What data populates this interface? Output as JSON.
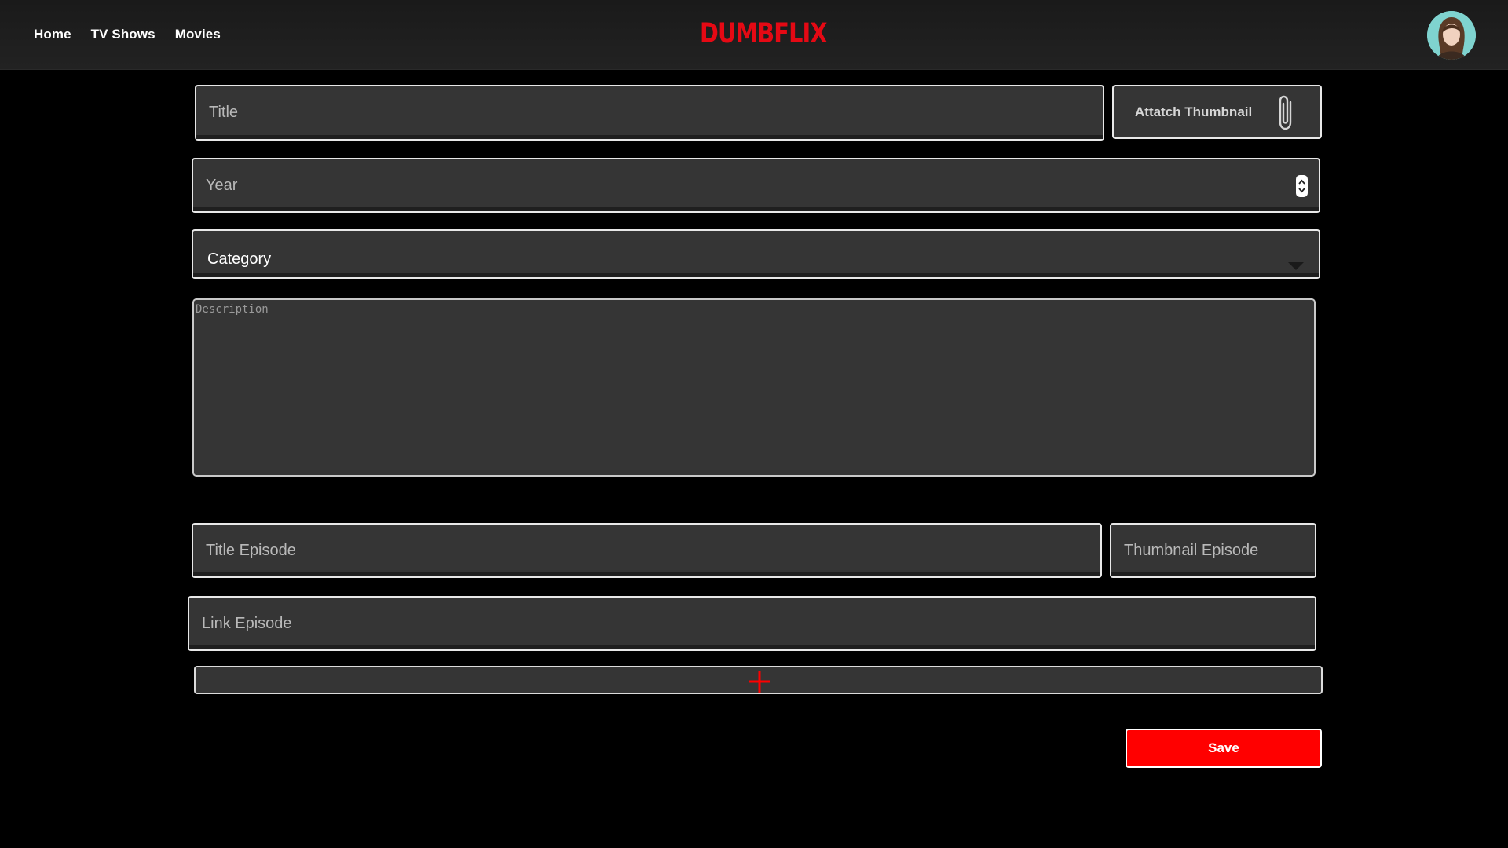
{
  "nav": {
    "links": [
      "Home",
      "TV Shows",
      "Movies"
    ],
    "logo": "DUMBFLIX",
    "brand_color": "#e50914"
  },
  "form": {
    "title_placeholder": "Title",
    "attach_thumbnail_label": "Attatch Thumbnail",
    "attach_icon": "paperclip-icon",
    "year_placeholder": "Year",
    "category_label": "Category",
    "description_placeholder": "Description",
    "episode_title_placeholder": "Title Episode",
    "episode_thumbnail_placeholder": "Thumbnail Episode",
    "episode_link_placeholder": "Link Episode",
    "add_episode_icon": "plus-icon",
    "save_label": "Save",
    "save_color": "#ff0000"
  }
}
